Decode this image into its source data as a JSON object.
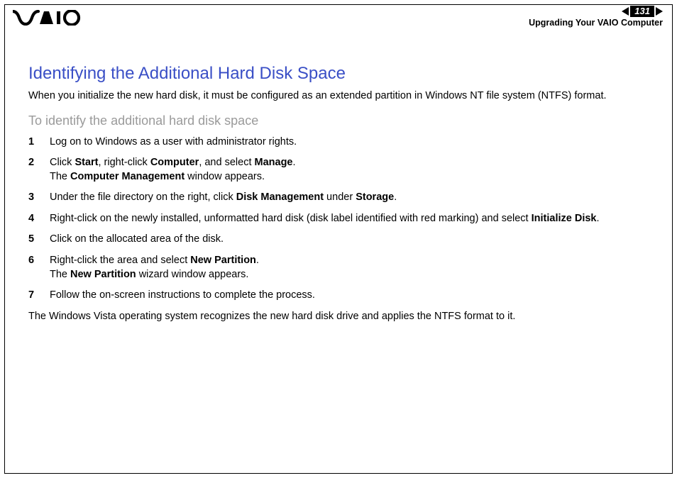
{
  "header": {
    "page_number": "131",
    "section": "Upgrading Your VAIO Computer"
  },
  "content": {
    "title": "Identifying the Additional Hard Disk Space",
    "intro": "When you initialize the new hard disk, it must be configured as an extended partition in Windows NT file system (NTFS) format.",
    "subhead": "To identify the additional hard disk space",
    "steps": {
      "s1": "Log on to Windows as a user with administrator rights.",
      "s2a": "Click ",
      "s2b": "Start",
      "s2c": ", right-click ",
      "s2d": "Computer",
      "s2e": ", and select ",
      "s2f": "Manage",
      "s2g": ".",
      "s2h": "The ",
      "s2i": "Computer Management",
      "s2j": " window appears.",
      "s3a": "Under the file directory on the right, click ",
      "s3b": "Disk Management",
      "s3c": " under ",
      "s3d": "Storage",
      "s3e": ".",
      "s4a": "Right-click on the newly installed, unformatted hard disk (disk label identified with red marking) and select ",
      "s4b": "Initialize Disk",
      "s4c": ".",
      "s5": "Click on the allocated area of the disk.",
      "s6a": "Right-click the area and select ",
      "s6b": "New Partition",
      "s6c": ".",
      "s6d": "The ",
      "s6e": "New Partition",
      "s6f": " wizard window appears.",
      "s7": "Follow the on-screen instructions to complete the process."
    },
    "outro": "The Windows Vista operating system recognizes the new hard disk drive and applies the NTFS format to it."
  }
}
